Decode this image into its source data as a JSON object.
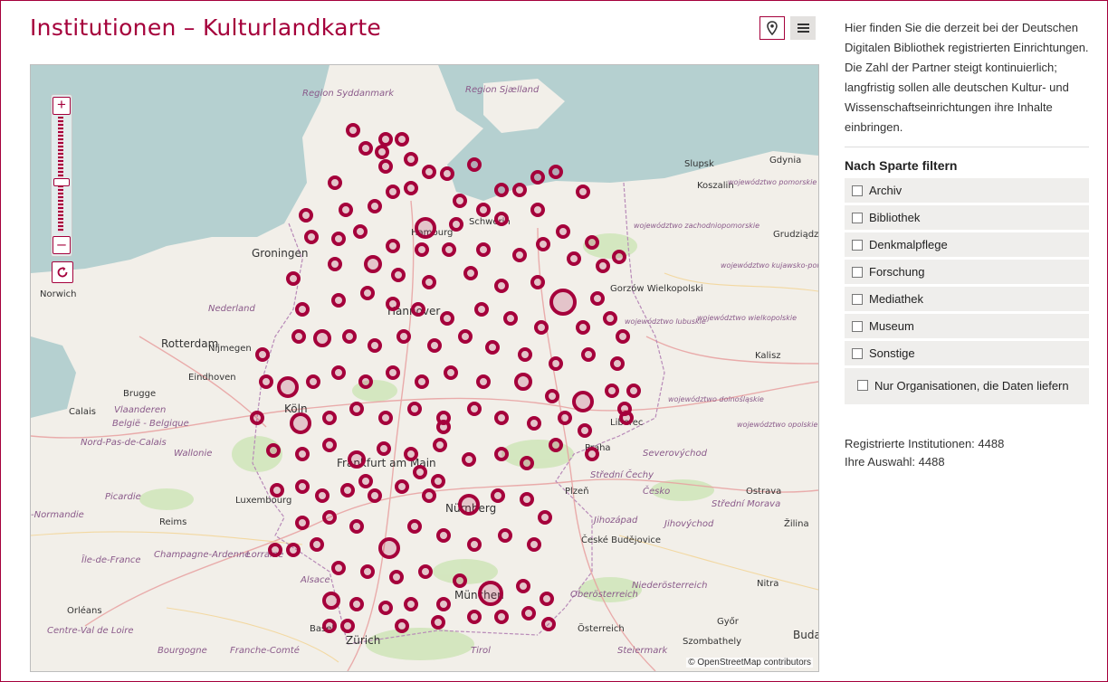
{
  "page": {
    "title": "Institutionen – Kulturlandkarte",
    "view_toggle": {
      "map_icon": "map-marker-icon",
      "list_icon": "list-icon"
    }
  },
  "map": {
    "zoom_in_label": "+",
    "zoom_out_label": "–",
    "attribution": "© OpenStreetMap contributors",
    "colors": {
      "marker": "#a5003b",
      "water": "#b5d0d0",
      "land": "#f2efe9"
    },
    "labels": [
      {
        "text": "Region Syddanmark"
      },
      {
        "text": "Region Sjælland"
      },
      {
        "text": "Hamburg"
      },
      {
        "text": "Schwerin"
      },
      {
        "text": "Groningen"
      },
      {
        "text": "Norwich"
      },
      {
        "text": "Nederland"
      },
      {
        "text": "Rotterdam"
      },
      {
        "text": "Nijmegen"
      },
      {
        "text": "Eindhoven"
      },
      {
        "text": "Brugge"
      },
      {
        "text": "Calais"
      },
      {
        "text": "Vlaanderen"
      },
      {
        "text": "België - Belgique"
      },
      {
        "text": "Nord-Pas-de-Calais"
      },
      {
        "text": "Wallonie"
      },
      {
        "text": "Picardie"
      },
      {
        "text": "Luxembourg"
      },
      {
        "text": "Reims"
      },
      {
        "text": "-Normandie"
      },
      {
        "text": "Champagne-Ardenne"
      },
      {
        "text": "Lorraine"
      },
      {
        "text": "Île-de-France"
      },
      {
        "text": "Alsace"
      },
      {
        "text": "Orléans"
      },
      {
        "text": "Centre-Val de Loire"
      },
      {
        "text": "Bourgogne"
      },
      {
        "text": "Franche-Comté"
      },
      {
        "text": "Zürich"
      },
      {
        "text": "Slupsk"
      },
      {
        "text": "Gdynia"
      },
      {
        "text": "Koszalin"
      },
      {
        "text": "Grudziądz"
      },
      {
        "text": "Gorzów Wielkopolski"
      },
      {
        "text": "Kalisz"
      },
      {
        "text": "Liberec"
      },
      {
        "text": "Plzeň"
      },
      {
        "text": "Praha"
      },
      {
        "text": "Ostrava"
      },
      {
        "text": "Česko"
      },
      {
        "text": "Střední Čechy"
      },
      {
        "text": "Jihozápad"
      },
      {
        "text": "Jihovýchod"
      },
      {
        "text": "České Budějovice"
      },
      {
        "text": "Severovýchod"
      },
      {
        "text": "Střední Morava"
      },
      {
        "text": "Žilina"
      },
      {
        "text": "Nitra"
      },
      {
        "text": "Niederösterreich"
      },
      {
        "text": "Oberösterreich"
      },
      {
        "text": "Österreich"
      },
      {
        "text": "Győr"
      },
      {
        "text": "Budap"
      },
      {
        "text": "Tirol"
      },
      {
        "text": "Steiermark"
      },
      {
        "text": "Szombathely"
      },
      {
        "text": "Frankfurt am Main"
      },
      {
        "text": "München"
      },
      {
        "text": "Nürnberg"
      },
      {
        "text": "Hannover"
      },
      {
        "text": "Köln"
      },
      {
        "text": "Basel"
      },
      {
        "text": "województwo pomorskie"
      },
      {
        "text": "województwo zachodniopomorskie"
      },
      {
        "text": "województwo kujawsko-pomorskie"
      },
      {
        "text": "województwo lubuskie"
      },
      {
        "text": "województwo wielkopolskie"
      },
      {
        "text": "województwo dolnośląskie"
      },
      {
        "text": "województwo opolskie"
      }
    ]
  },
  "sidebar": {
    "intro": "Hier finden Sie die derzeit bei der Deutschen Digitalen Bibliothek registrierten Einrichtungen. Die Zahl der Partner steigt kontinuierlich; langfristig sollen alle deutschen Kultur- und Wissenschaftseinrichtungen ihre Inhalte einbringen.",
    "filter_heading": "Nach Sparte filtern",
    "filters": [
      {
        "label": "Archiv"
      },
      {
        "label": "Bibliothek"
      },
      {
        "label": "Denkmalpflege"
      },
      {
        "label": "Forschung"
      },
      {
        "label": "Mediathek"
      },
      {
        "label": "Museum"
      },
      {
        "label": "Sonstige"
      },
      {
        "label": "Nur Organisationen, die Daten liefern"
      }
    ],
    "stats": {
      "registered": "Registrierte Institutionen: 4488",
      "selection": "Ihre Auswahl: 4488"
    }
  }
}
